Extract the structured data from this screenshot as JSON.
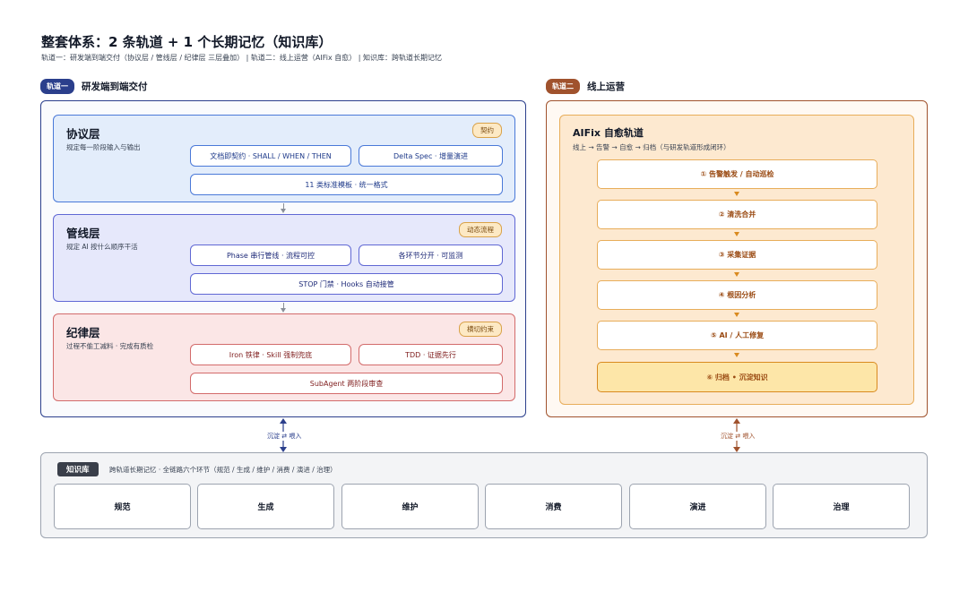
{
  "title": "整套体系：2 条轨道 + 1 个长期记忆（知识库）",
  "subtitle": "轨道一：研发端到端交付（协议层 / 管线层 / 纪律层 三层叠加）   |   轨道二：线上运营（AIFix 自愈）   |   知识库：跨轨道长期记忆",
  "track_one": {
    "tag": "轨道一",
    "title": "研发端到端交付",
    "layers": [
      {
        "name": "协议层",
        "desc": "规定每一阶段输入与输出",
        "badge": "契约",
        "chips": [
          "文档即契约 · SHALL / WHEN / THEN",
          "Delta Spec · 增量演进",
          "11 类标准模板 · 统一格式"
        ]
      },
      {
        "name": "管线层",
        "desc": "规定 AI 按什么顺序干活",
        "badge": "动态流程",
        "chips": [
          "Phase 串行管线 · 流程可控",
          "各环节分开 · 可监测",
          "STOP 门禁 · Hooks 自动接管"
        ]
      },
      {
        "name": "纪律层",
        "desc": "过程不偷工减料 · 完成有质检",
        "badge": "横切约束",
        "chips": [
          "Iron 铁律 · Skill 强制兜底",
          "TDD · 证据先行",
          "SubAgent 两阶段审查"
        ]
      }
    ]
  },
  "track_two": {
    "tag": "轨道二",
    "title": "线上运营",
    "box_title": "AIFix 自愈轨道",
    "box_desc": "线上 → 告警 → 自愈 → 归档（与研发轨道形成闭环）",
    "steps": [
      "① 告警触发 / 自动巡检",
      "② 清洗合并",
      "③ 采集证据",
      "④ 根因分析",
      "⑤ AI / 人工修复",
      "⑥ 归档 • 沉淀知识"
    ]
  },
  "connector_label": "沉淀 ⇄ 喂入",
  "knowledge_base": {
    "tag": "知识库",
    "desc": "跨轨道长期记忆 · 全链路六个环节（规范 / 生成 / 维护 / 消费 / 演进 / 治理）",
    "items": [
      "规范",
      "生成",
      "维护",
      "消费",
      "演进",
      "治理"
    ]
  },
  "colors": {
    "track_one": "#2b3f8c",
    "track_two": "#a0522d",
    "knowledge": "#3a3f4a"
  }
}
